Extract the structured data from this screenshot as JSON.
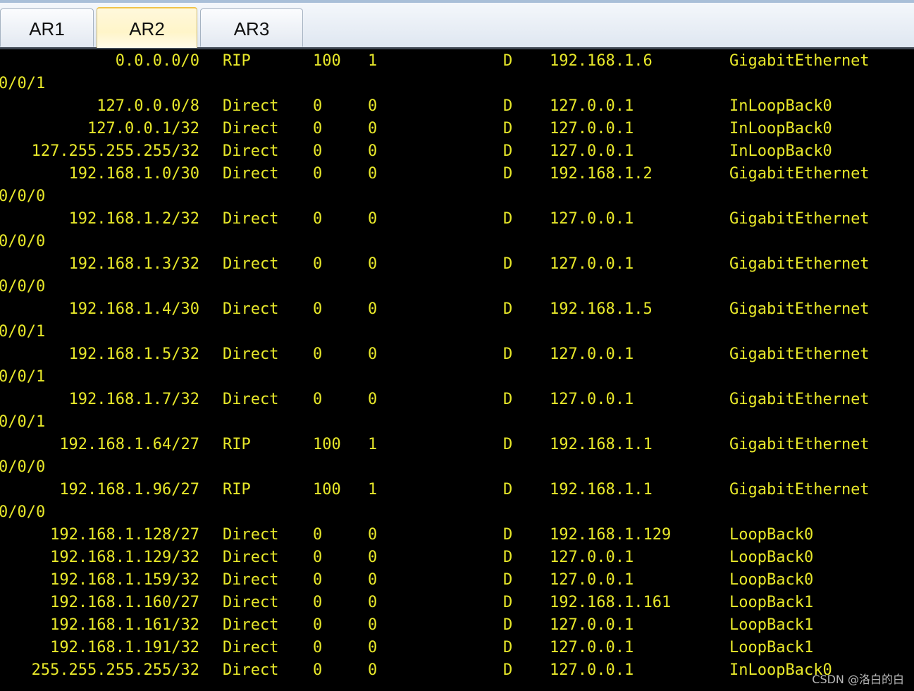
{
  "tabs": [
    {
      "label": "AR1",
      "active": false
    },
    {
      "label": "AR2",
      "active": true
    },
    {
      "label": "AR3",
      "active": false
    }
  ],
  "colors": {
    "console_bg": "#000000",
    "console_text": "#e8e82a",
    "active_tab": "#fff5c9"
  },
  "routes": [
    {
      "dest": "0.0.0.0/0",
      "proto": "RIP",
      "pre": "100",
      "cost": "1",
      "flags": "D",
      "nexthop": "192.168.1.6",
      "iface": "GigabitEthernet",
      "wrap": "0/0/1"
    },
    {
      "dest": "127.0.0.0/8",
      "proto": "Direct",
      "pre": "0",
      "cost": "0",
      "flags": "D",
      "nexthop": "127.0.0.1",
      "iface": "InLoopBack0",
      "wrap": ""
    },
    {
      "dest": "127.0.0.1/32",
      "proto": "Direct",
      "pre": "0",
      "cost": "0",
      "flags": "D",
      "nexthop": "127.0.0.1",
      "iface": "InLoopBack0",
      "wrap": ""
    },
    {
      "dest": "127.255.255.255/32",
      "proto": "Direct",
      "pre": "0",
      "cost": "0",
      "flags": "D",
      "nexthop": "127.0.0.1",
      "iface": "InLoopBack0",
      "wrap": ""
    },
    {
      "dest": "192.168.1.0/30",
      "proto": "Direct",
      "pre": "0",
      "cost": "0",
      "flags": "D",
      "nexthop": "192.168.1.2",
      "iface": "GigabitEthernet",
      "wrap": "0/0/0"
    },
    {
      "dest": "192.168.1.2/32",
      "proto": "Direct",
      "pre": "0",
      "cost": "0",
      "flags": "D",
      "nexthop": "127.0.0.1",
      "iface": "GigabitEthernet",
      "wrap": "0/0/0"
    },
    {
      "dest": "192.168.1.3/32",
      "proto": "Direct",
      "pre": "0",
      "cost": "0",
      "flags": "D",
      "nexthop": "127.0.0.1",
      "iface": "GigabitEthernet",
      "wrap": "0/0/0"
    },
    {
      "dest": "192.168.1.4/30",
      "proto": "Direct",
      "pre": "0",
      "cost": "0",
      "flags": "D",
      "nexthop": "192.168.1.5",
      "iface": "GigabitEthernet",
      "wrap": "0/0/1"
    },
    {
      "dest": "192.168.1.5/32",
      "proto": "Direct",
      "pre": "0",
      "cost": "0",
      "flags": "D",
      "nexthop": "127.0.0.1",
      "iface": "GigabitEthernet",
      "wrap": "0/0/1"
    },
    {
      "dest": "192.168.1.7/32",
      "proto": "Direct",
      "pre": "0",
      "cost": "0",
      "flags": "D",
      "nexthop": "127.0.0.1",
      "iface": "GigabitEthernet",
      "wrap": "0/0/1"
    },
    {
      "dest": "192.168.1.64/27",
      "proto": "RIP",
      "pre": "100",
      "cost": "1",
      "flags": "D",
      "nexthop": "192.168.1.1",
      "iface": "GigabitEthernet",
      "wrap": "0/0/0"
    },
    {
      "dest": "192.168.1.96/27",
      "proto": "RIP",
      "pre": "100",
      "cost": "1",
      "flags": "D",
      "nexthop": "192.168.1.1",
      "iface": "GigabitEthernet",
      "wrap": "0/0/0"
    },
    {
      "dest": "192.168.1.128/27",
      "proto": "Direct",
      "pre": "0",
      "cost": "0",
      "flags": "D",
      "nexthop": "192.168.1.129",
      "iface": "LoopBack0",
      "wrap": ""
    },
    {
      "dest": "192.168.1.129/32",
      "proto": "Direct",
      "pre": "0",
      "cost": "0",
      "flags": "D",
      "nexthop": "127.0.0.1",
      "iface": "LoopBack0",
      "wrap": ""
    },
    {
      "dest": "192.168.1.159/32",
      "proto": "Direct",
      "pre": "0",
      "cost": "0",
      "flags": "D",
      "nexthop": "127.0.0.1",
      "iface": "LoopBack0",
      "wrap": ""
    },
    {
      "dest": "192.168.1.160/27",
      "proto": "Direct",
      "pre": "0",
      "cost": "0",
      "flags": "D",
      "nexthop": "192.168.1.161",
      "iface": "LoopBack1",
      "wrap": ""
    },
    {
      "dest": "192.168.1.161/32",
      "proto": "Direct",
      "pre": "0",
      "cost": "0",
      "flags": "D",
      "nexthop": "127.0.0.1",
      "iface": "LoopBack1",
      "wrap": ""
    },
    {
      "dest": "192.168.1.191/32",
      "proto": "Direct",
      "pre": "0",
      "cost": "0",
      "flags": "D",
      "nexthop": "127.0.0.1",
      "iface": "LoopBack1",
      "wrap": ""
    },
    {
      "dest": "255.255.255.255/32",
      "proto": "Direct",
      "pre": "0",
      "cost": "0",
      "flags": "D",
      "nexthop": "127.0.0.1",
      "iface": "InLoopBack0",
      "wrap": ""
    }
  ],
  "watermark": "CSDN @洛白的白"
}
